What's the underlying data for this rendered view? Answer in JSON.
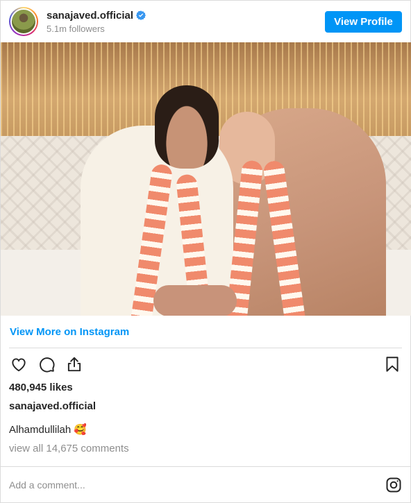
{
  "header": {
    "username": "sanajaved.official",
    "followers": "5.1m followers",
    "view_profile_label": "View Profile",
    "verified_icon": "verified-badge-icon"
  },
  "post": {
    "view_more_label": "View More on Instagram",
    "likes": "480,945 likes",
    "owner": "sanajaved.official",
    "caption": "Alhamdullilah 🥰",
    "comments_link": "view all 14,675 comments"
  },
  "actions": {
    "icons": [
      "heart-icon",
      "comment-icon",
      "share-icon",
      "bookmark-icon"
    ]
  },
  "comment_box": {
    "placeholder": "Add a comment..."
  },
  "colors": {
    "accent": "#0095f6",
    "text": "#262626",
    "muted": "#8e8e8e",
    "border": "#dbdbdb"
  }
}
